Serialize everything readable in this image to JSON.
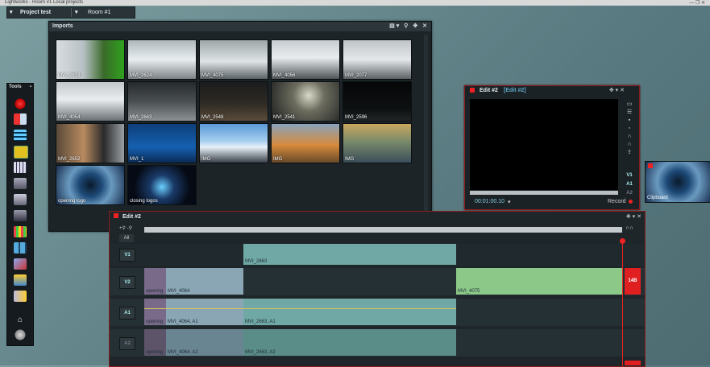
{
  "window": {
    "title": "Lightworks - Room #1    Local projects",
    "controls": "— ❐ ✕"
  },
  "project": {
    "name": "Project test",
    "room": "Room #1"
  },
  "imports": {
    "title": "Imports",
    "header_icons": "▤▾ ⚲ ✥ ✕",
    "thumbs": [
      {
        "label": "MVI_2613",
        "bg": "linear-gradient(90deg,#d8dde0 0%,#b7c0c4 40%,#3a6a2a 70%,#2fa21e 100%)"
      },
      {
        "label": "MVI_2624",
        "bg": "linear-gradient(180deg,#aeb7bb 0%,#e9eef0 50%,#7d8386 100%)"
      },
      {
        "label": "MVI_4075",
        "bg": "linear-gradient(180deg,#9ea6a8 0%,#dfe5e7 55%,#5b6366 100%)"
      },
      {
        "label": "MVI_4056",
        "bg": "linear-gradient(180deg,#c7ccd0 0%,#e8ecee 45%,#4f5558 100%)"
      },
      {
        "label": "MVI_2077",
        "bg": "linear-gradient(180deg,#bfc4c7 0%,#e4e8ea 50%,#5c6265 100%)"
      },
      {
        "label": "MVI_4054",
        "bg": "linear-gradient(180deg,#c3c8cb 0%,#e9edef 45%,#6a7174 100%)"
      },
      {
        "label": "MVI_2663",
        "bg": "linear-gradient(180deg,#262a2c 0%,#4a4f52 50%,#8c9194 100%)"
      },
      {
        "label": "MVI_2548",
        "bg": "linear-gradient(180deg,#1a1c1d 0%,#2e2a24 55%,#5a4c3a 100%)"
      },
      {
        "label": "MVI_2541",
        "bg": "radial-gradient(circle at 55% 35%,#d9d9c8 0%,#6c6c5e 35%,#1d1f1f 100%)"
      },
      {
        "label": "MVI_2596",
        "bg": "linear-gradient(180deg,#050607 0%,#0e1112 70%,#1f2426 100%)"
      },
      {
        "label": "MVI_2652",
        "bg": "linear-gradient(90deg,#5a4a3a 0%,#b88a60 40%,#2a2a2a 70%,#9aa0a4 100%)"
      },
      {
        "label": "MVI_1",
        "bg": "linear-gradient(180deg,#0e3f7a 0%,#1560b0 60%,#0a2a55 100%)"
      },
      {
        "label": "IMG",
        "bg": "linear-gradient(180deg,#5a9ad8 0%,#a8d0ef 45%,#e8f2f8 60%,#3a4048 100%)"
      },
      {
        "label": "IMG",
        "bg": "linear-gradient(180deg,#8aa4bc 0%,#d68a3c 55%,#6a4a2a 100%)"
      },
      {
        "label": "IMG",
        "bg": "linear-gradient(180deg,#c9a860 0%,#7a8a6a 45%,#3a4e5a 100%)"
      },
      {
        "label": "opening logo",
        "bg": "radial-gradient(circle at 50% 50%,#0b1a2c 0%,#1e4a78 30%,#6a9ac0 55%,#1a3050 100%)"
      },
      {
        "label": "closing logos",
        "bg": "radial-gradient(circle at 50% 55%,#6ad0ff 0%,#1a3a68 30%,#050a14 70%)"
      }
    ]
  },
  "tools": {
    "title": "Tools"
  },
  "viewer": {
    "title": "Edit #2",
    "subtitle": "[Edit #2]",
    "header_icons": "✥ ▾ ✕",
    "timecode": "00:01:00.10",
    "record_label": "Record",
    "track_labels": [
      "V1",
      "A1",
      "A2"
    ]
  },
  "clipboard": {
    "label": "Clipboard"
  },
  "timeline": {
    "title": "Edit #2",
    "header_icons": "✥ ▾ ✕",
    "all_label": "All",
    "zoom_icons": "+⚲ -⚲",
    "end_icons": "∩∩",
    "tracks": [
      {
        "label": "V1"
      },
      {
        "label": "V2"
      },
      {
        "label": "A1"
      },
      {
        "label": "A2"
      }
    ],
    "v1_clip": "MVI_2663",
    "v2_opening": "opening",
    "v2_clip1": "MVI_4064",
    "v2_clip2": "MVI_4075",
    "a1_opening": "opening",
    "a1_clip1": "MVI_4064, A1",
    "a1_clip2": "MVI_2663, A1",
    "a2_opening": "opening",
    "a2_clip1": "MVI_4064, A2",
    "a2_clip2": "MVI_2663, A2",
    "end_tag": "14B"
  }
}
